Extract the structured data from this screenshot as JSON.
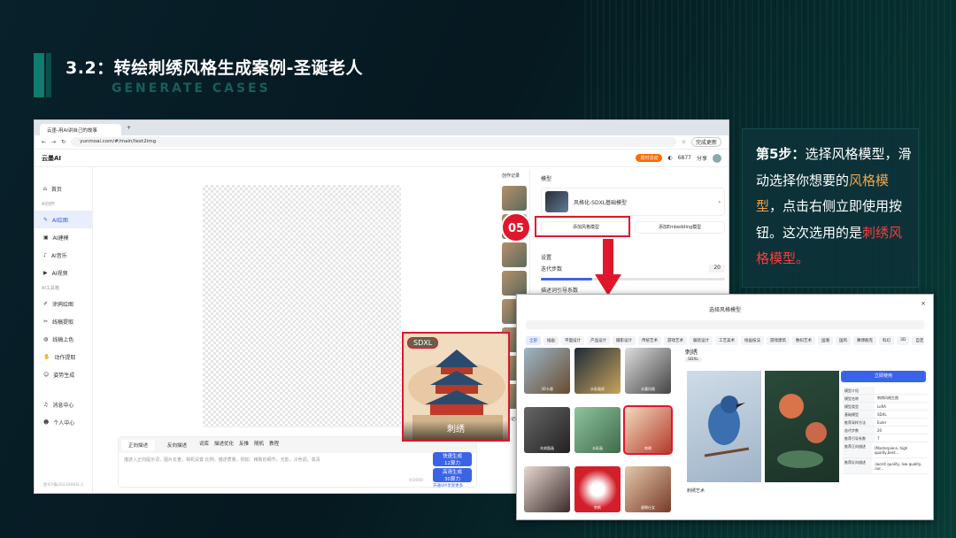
{
  "slide": {
    "title": "3.2：转绘刺绣风格生成案例-圣诞老人",
    "subtitle": "GENERATE CASES"
  },
  "browser": {
    "tab_title": "云墨-用AI讲自己的故事",
    "url": "yunmoai.com/#/main/text2img",
    "update_label": "完成更新"
  },
  "app": {
    "logo": "云墨AI",
    "vip_label": "限时活动",
    "points": "6877",
    "share": "分享"
  },
  "sidebar": {
    "items": [
      "首页",
      "AI创作",
      "AI绘图",
      "AI建模",
      "AI音乐",
      "AI视频",
      "AI工具箱",
      "涂鸦绘图",
      "线稿提取",
      "线稿上色",
      "动作提取",
      "姿势生成",
      "消息中心",
      "个人中心"
    ],
    "footer": "浙ICP备2023008号-2"
  },
  "prompt": {
    "tab1": "正向描述",
    "tab2": "反向描述",
    "tools": [
      "词库",
      "描述优化",
      "反推",
      "随机",
      "教程"
    ],
    "placeholder": "描述入正向提示词，图片长宽，相机设置 比例，描述质量，例如：精致的细节，光影，冷色调，高清",
    "counter": "0/2000",
    "gen1": "快速生成",
    "gen1_sub": "12算力",
    "gen2": "高清生成",
    "gen2_sub": "30算力",
    "more": "开通VIP享受更多"
  },
  "history": {
    "label": "创作记录",
    "more": "更多记录"
  },
  "right": {
    "model_section": "模型",
    "model_name": "风格化-SDXL基础模型",
    "add_style": "添加风格模型",
    "add_emb": "添加Embedding模型",
    "settings": "设置",
    "steps": "迭代步数",
    "steps_value": "20",
    "cfg": "描述词引导系数"
  },
  "step_badge": "05",
  "zoom": {
    "tag": "SDXL",
    "label": "刺绣"
  },
  "callout": {
    "step": "第5步：",
    "t1": "选择风格模型，滑动选择你想要的",
    "hl1": "风格模型",
    "t2": "，点击右侧立即使用按钮。这次选用的是",
    "red": "刺绣风格模型。"
  },
  "modal": {
    "title": "选择风格模型",
    "categories": [
      "全部",
      "插画",
      "平面设计",
      "产品设计",
      "摄影设计",
      "传统艺术",
      "游戏艺术",
      "服装设计",
      "工艺美术",
      "绘画技法",
      "游戏建筑",
      "数码艺术",
      "国潮",
      "国风",
      "赛博朋克",
      "科幻",
      "3D",
      "自定义模型(不可选)"
    ],
    "tiles": [
      "3D卡通",
      "水彩画质",
      "水墨风格",
      "木刻版画",
      "水彩画",
      "刺绣",
      "",
      "剪纸",
      "唐朝仕女"
    ],
    "detail_title": "刺绣",
    "detail_tag": "SDXL",
    "use_label": "立即使用",
    "desc_label": "刺绣艺术",
    "params": [
      [
        "模型介绍",
        ""
      ],
      [
        "模型名称",
        "刺绣风格生图"
      ],
      [
        "模型类型",
        "LoRA"
      ],
      [
        "基础模型",
        "SDXL"
      ],
      [
        "推荐采样方法",
        "Euler"
      ],
      [
        "迭代步数",
        "20"
      ],
      [
        "推荐引导系数",
        "7"
      ],
      [
        "推荐正向描述",
        "(Masterpiece, high quality,best..."
      ],
      [
        "推荐反向描述",
        "(worst quality, low quality, nor..."
      ]
    ]
  }
}
